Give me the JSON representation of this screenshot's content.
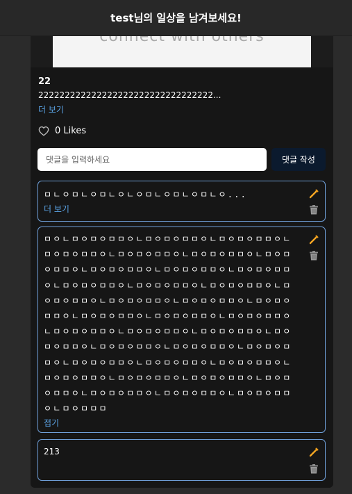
{
  "header": {
    "title": "test님의 일상을 남겨보세요!"
  },
  "post": {
    "image_text": "connect with others",
    "title": "22",
    "body_preview": "222222222222222222222222222222222...",
    "more_label": "더 보기"
  },
  "likes": {
    "count_label": "0 Likes",
    "icon": "heart-outline-icon"
  },
  "comment_form": {
    "placeholder": "댓글을 입력하세요",
    "submit_label": "댓글 작성"
  },
  "comments": [
    {
      "text": "ㅁㄴㅇㅁㄴㅇㅁㄴㅇㄴㅇㅁㄴㅇㅁㄴㅇㅁㄴㅇ...",
      "link_label": "더 보기"
    },
    {
      "text": "ㅁㅇㄴㅁㅇㅁㅇㅁㅁㅇㄴㅁㅇㅁㅇㅁㅁㅇㄴㅁㅇㅁㅇㅁㅁㅇㄴㅁㅇㅁㅇㅁㅁㅇㄴㅁㅇㅁㅇㅁㅁㅇㄴㅁㅇㅁㅇㅁㅁㅇㄴㅁㅇㅁㅇㅁㅁㅇㄴㅁㅇㅁㅇㅁㅁㅇㄴㅁㅇㅁㅇㅁㅁㅇㄴㅁㅇㅁㅇㅁㅁㅇㄴㅁㅇㅁㅇㅁㅁㅇㄴㅁㅇㅁㅇㅁㅁㅇㄴㅁㅇㅁㅇㅁㅁㅇㄴㅁㅇㅁㅇㅁㅁㅇㄴㅁㅇㅁㅇㅁㅁㅇㄴㅁㅇㅁㅇㅁㅁㅇㄴㅁㅇㅁㅇㅁㅁㅇㄴㅁㅇㅁㅇㅁㅁㅇㄴㅁㅇㅁㅇㅁㅁㅇㄴㅁㅇㅁㅇㅁㅁㅇㄴㅁㅇㅁㅇㅁㅁㅇㄴㅁㅇㅁㅇㅁㅁㅇㄴㅁㅇㅁㅇㅁㅁㅇㄴㅁㅇㅁㅇㅁㅁㅇㄴㅁㅇㅁㅇㅁㅁㅇㄴㅁㅇㅁㅇㅁㅁㅇㄴㅁㅇㅁㅇㅁㅁㅇㄴㅁㅇㅁㅇㅁㅁㅇㄴㅁㅇㅁㅇㅁㅁㅇㄴㅁㅇㅁㅇㅁㅁㅇㄴㅁㅇㅁㅇㅁㅁㅇㄴㅁㅇㅁㅇㅁㅁㅇㄴㅁㅇㅁㅇㅁㅁㅇㄴㅁㅇㅁㅇㅁㅁㅇㄴㅁㅇㅁㅇㅁㅁㅇㄴㅁㅇㅁㅇㅁㅁㅇㄴㅁㅇㅁㅇㅁㅁㅇㄴㅁㅇㅁㅁㅁ",
      "link_label": "접기"
    },
    {
      "text": "213",
      "link_label": ""
    }
  ],
  "icons": {
    "edit": "pencil-icon",
    "delete": "trash-icon"
  },
  "colors": {
    "background": "#2b2b2b",
    "card": "#161616",
    "link": "#5ba4e6",
    "comment_border": "#6f9fd8",
    "submit_button": "#0b1a2e",
    "pencil": "#f5a623"
  }
}
